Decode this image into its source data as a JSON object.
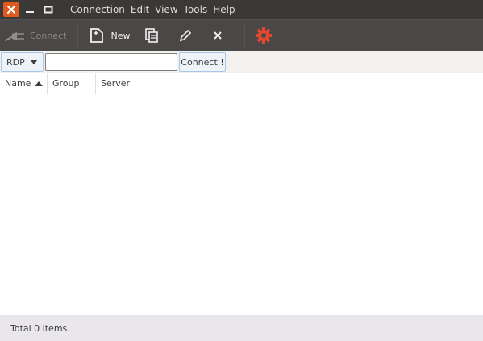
{
  "window": {
    "buttons": [
      "close",
      "minimize",
      "maximize"
    ]
  },
  "menu": {
    "items": [
      {
        "label": "Connection"
      },
      {
        "label": "Edit"
      },
      {
        "label": "View"
      },
      {
        "label": "Tools"
      },
      {
        "label": "Help"
      }
    ]
  },
  "toolbar": {
    "connect_label": "Connect",
    "new_label": "New",
    "icons": [
      "plug-icon",
      "new-document-icon",
      "copy-icon",
      "edit-pencil-icon",
      "delete-icon",
      "preferences-gear-icon"
    ],
    "gear_color": "#e3472f"
  },
  "quick_connect": {
    "protocol": "RDP",
    "input_value": "",
    "button_label": "Connect !"
  },
  "table": {
    "columns": [
      {
        "label": "Name"
      },
      {
        "label": "Group"
      },
      {
        "label": "Server"
      }
    ],
    "sort_column": "Name",
    "sort_direction": "ascending",
    "rows": []
  },
  "status": {
    "text": "Total 0 items."
  },
  "colors": {
    "menubar_bg": "#3a3937",
    "toolbar_bg": "#494847",
    "close_button": "#e05a1f",
    "status_bg": "#e9e7ec"
  }
}
